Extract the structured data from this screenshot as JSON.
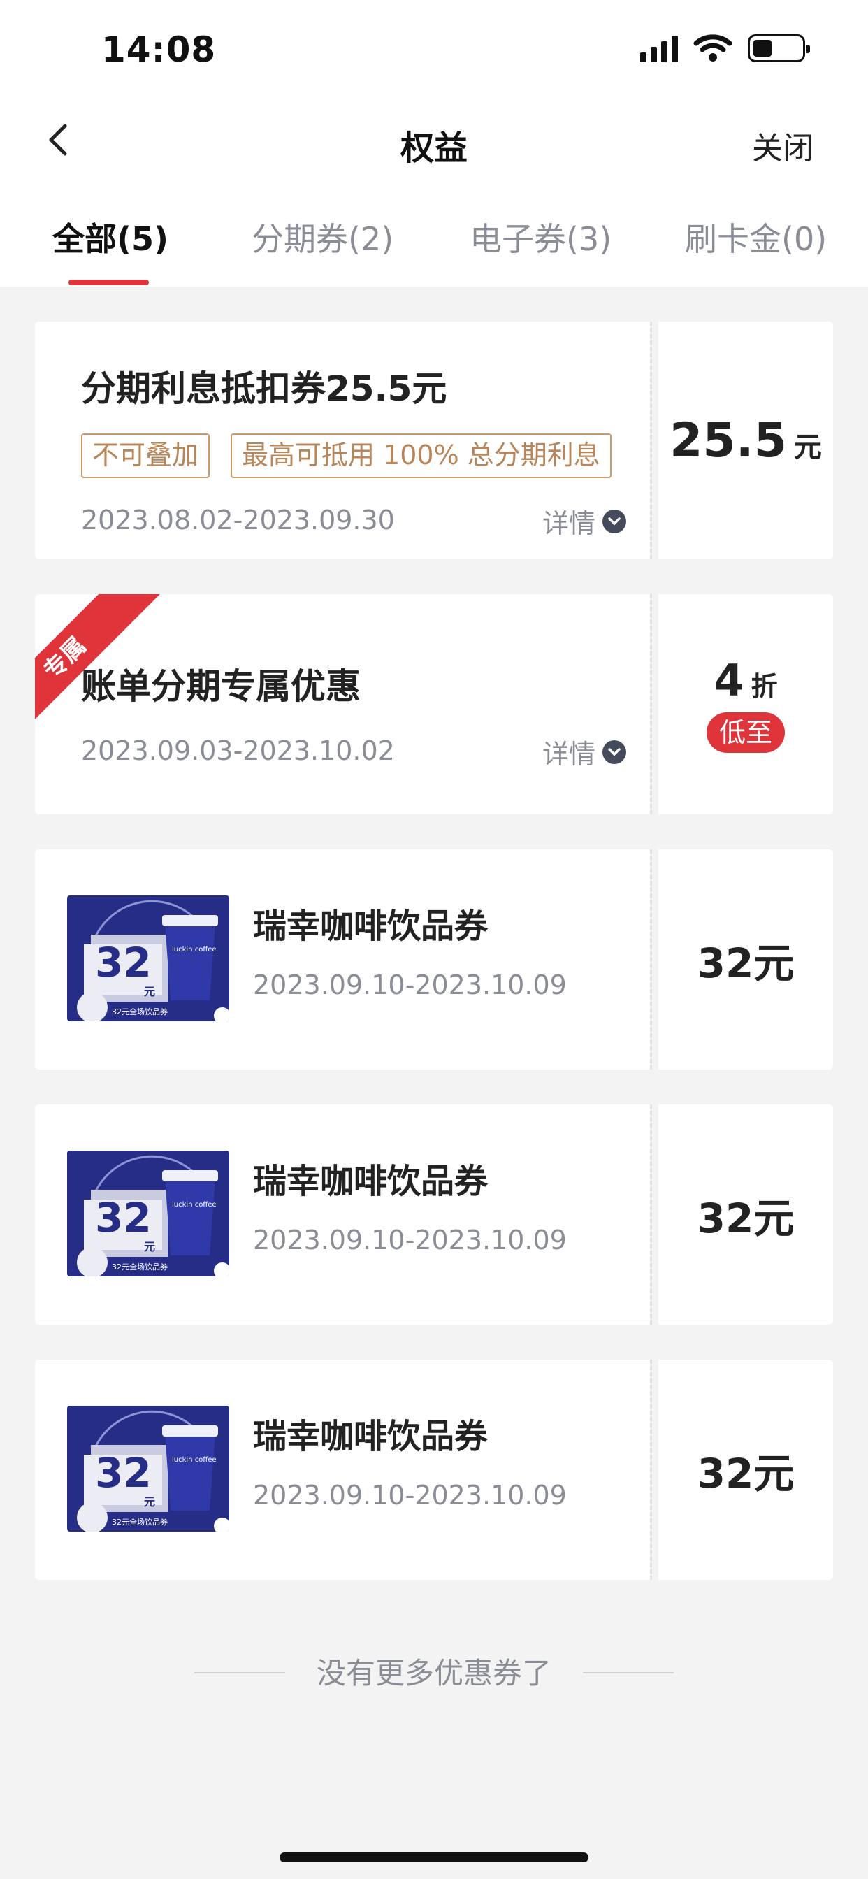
{
  "status": {
    "time": "14:08"
  },
  "nav": {
    "title": "权益",
    "close_label": "关闭"
  },
  "tabs": [
    {
      "label": "全部(5)"
    },
    {
      "label": "分期券(2)"
    },
    {
      "label": "电子券(3)"
    },
    {
      "label": "刷卡金(0)"
    }
  ],
  "cards": [
    {
      "title": "分期利息抵扣券25.5元",
      "tags": [
        "不可叠加",
        "最高可抵用 100% 总分期利息"
      ],
      "date": "2023.08.02-2023.09.30",
      "detail_label": "详情",
      "value": "25.5",
      "value_unit": "元"
    },
    {
      "ribbon": "专属",
      "title": "账单分期专属优惠",
      "date": "2023.09.03-2023.10.02",
      "detail_label": "详情",
      "value": "4",
      "value_unit": "折",
      "badge": "低至"
    },
    {
      "title": "瑞幸咖啡饮品券",
      "date": "2023.09.10-2023.10.09",
      "value": "32元",
      "thumb": {
        "big": "32",
        "unit": "元",
        "caption": "32元全场饮品券",
        "brand": "luckin coffee"
      }
    },
    {
      "title": "瑞幸咖啡饮品券",
      "date": "2023.09.10-2023.10.09",
      "value": "32元",
      "thumb": {
        "big": "32",
        "unit": "元",
        "caption": "32元全场饮品券",
        "brand": "luckin coffee"
      }
    },
    {
      "title": "瑞幸咖啡饮品券",
      "date": "2023.09.10-2023.10.09",
      "value": "32元",
      "thumb": {
        "big": "32",
        "unit": "元",
        "caption": "32元全场饮品券",
        "brand": "luckin coffee"
      }
    }
  ],
  "footer": {
    "text": "没有更多优惠券了"
  },
  "colors": {
    "accent": "#e0343b",
    "tag": "#b9865a",
    "thumb_bg": "#262d86"
  }
}
